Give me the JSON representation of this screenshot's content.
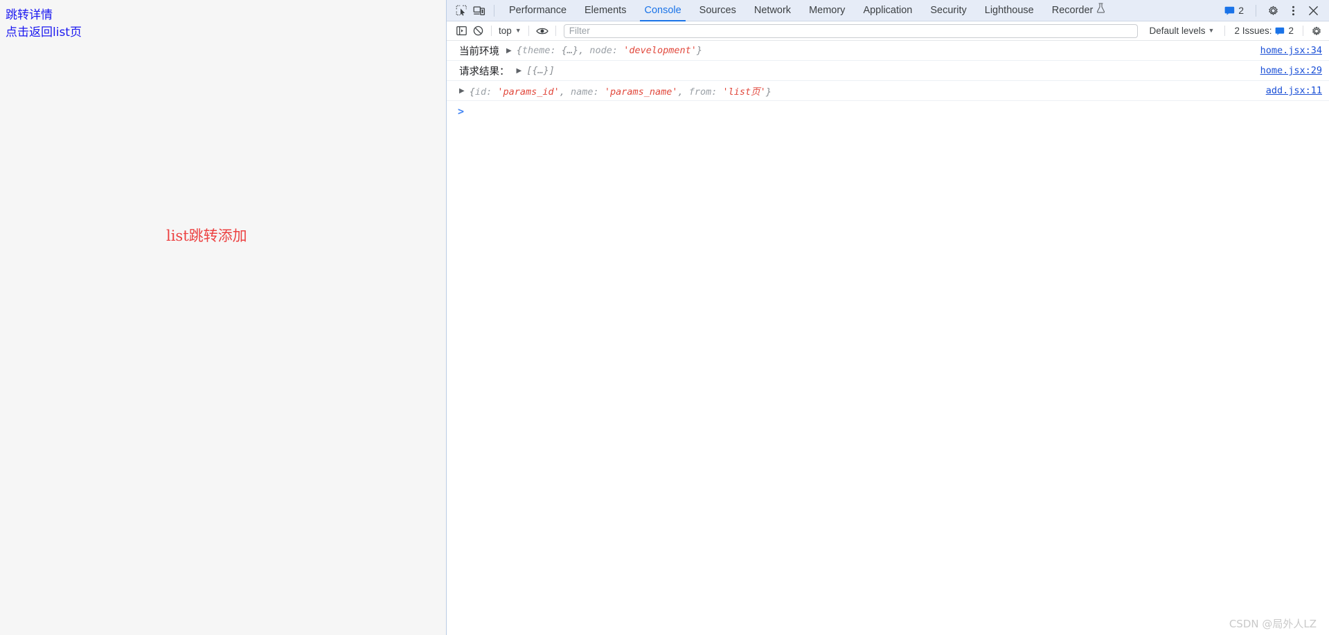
{
  "page": {
    "links": [
      {
        "label": "跳转详情",
        "name": "link-goto-detail"
      },
      {
        "label": "点击返回list页",
        "name": "link-back-to-list"
      }
    ],
    "center_text": "list跳转添加",
    "center_color": "#ec4141",
    "link_color": "#1a17f0",
    "background": "#f6f6f6"
  },
  "watermark": "CSDN @局外人LZ",
  "devtools": {
    "toolbar_icons": [
      {
        "name": "inspect-element-icon",
        "title": "Inspect element"
      },
      {
        "name": "device-toolbar-icon",
        "title": "Toggle device toolbar"
      }
    ],
    "tabs": [
      {
        "label": "Performance",
        "active": false
      },
      {
        "label": "Elements",
        "active": false
      },
      {
        "label": "Console",
        "active": true
      },
      {
        "label": "Sources",
        "active": false
      },
      {
        "label": "Network",
        "active": false
      },
      {
        "label": "Memory",
        "active": false
      },
      {
        "label": "Application",
        "active": false
      },
      {
        "label": "Security",
        "active": false
      },
      {
        "label": "Lighthouse",
        "active": false
      },
      {
        "label": "Recorder",
        "active": false,
        "icon": "flask-icon"
      }
    ],
    "active_tab": "Console",
    "accent_color": "#1a73e8",
    "tabbar_background": "#e6ecf7",
    "messages_badge": "2",
    "right_icons": [
      {
        "name": "settings-gear-icon"
      },
      {
        "name": "more-options-icon"
      },
      {
        "name": "close-devtools-icon"
      }
    ],
    "console_toolbar": {
      "sidebar_toggle": "console-sidebar-icon",
      "clear_console": "clear-console-icon",
      "context_label": "top",
      "eye_icon": "live-expressions-eye-icon",
      "filter_placeholder": "Filter",
      "filter_value": "",
      "levels_label": "Default levels",
      "issues_label": "2 Issues:",
      "issues_count": "2",
      "settings_icon": "console-settings-gear-icon"
    },
    "console_logs": [
      {
        "label": "当前环境",
        "has_disclosure": true,
        "preview_parts": [
          {
            "t": "{",
            "c": "punc"
          },
          {
            "t": "theme: ",
            "c": "key"
          },
          {
            "t": "{…}",
            "c": "punc"
          },
          {
            "t": ", ",
            "c": "punc"
          },
          {
            "t": "node: ",
            "c": "key"
          },
          {
            "t": "'development'",
            "c": "str"
          },
          {
            "t": "}",
            "c": "punc"
          }
        ],
        "source": "home.jsx:34"
      },
      {
        "label": "请求结果：",
        "has_disclosure": true,
        "preview_parts": [
          {
            "t": "[{…}]",
            "c": "punc"
          }
        ],
        "source": "home.jsx:29"
      },
      {
        "label": "",
        "has_disclosure": true,
        "preview_parts": [
          {
            "t": "{",
            "c": "punc"
          },
          {
            "t": "id: ",
            "c": "key"
          },
          {
            "t": "'params_id'",
            "c": "str"
          },
          {
            "t": ", ",
            "c": "punc"
          },
          {
            "t": "name: ",
            "c": "key"
          },
          {
            "t": "'params_name'",
            "c": "str"
          },
          {
            "t": ", ",
            "c": "punc"
          },
          {
            "t": "from: ",
            "c": "key"
          },
          {
            "t": "'list页'",
            "c": "str"
          },
          {
            "t": "}",
            "c": "punc"
          }
        ],
        "source": "add.jsx:11"
      }
    ],
    "prompt_symbol": ">"
  }
}
